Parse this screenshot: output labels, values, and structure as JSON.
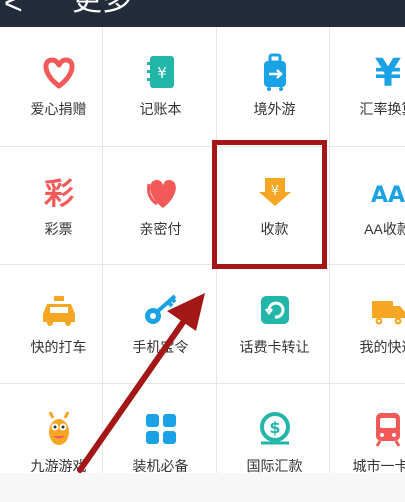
{
  "header": {
    "back_glyph": "<",
    "title": "更多"
  },
  "items": [
    {
      "label": "爱心捐赠",
      "icon": "heart-donate-icon",
      "color": "#f25a5a"
    },
    {
      "label": "记账本",
      "icon": "ledger-icon",
      "color": "#22b6a8"
    },
    {
      "label": "境外游",
      "icon": "luggage-icon",
      "color": "#1aa2e6"
    },
    {
      "label": "汇率换算",
      "icon": "currency-exchange-icon",
      "color": "#1aa2e6"
    },
    {
      "label": "彩票",
      "icon": "lottery-icon",
      "color": "#f25a5a"
    },
    {
      "label": "亲密付",
      "icon": "hearts-pay-icon",
      "color": "#f25a5a"
    },
    {
      "label": "收款",
      "icon": "receive-money-icon",
      "color": "#f6a623"
    },
    {
      "label": "AA收款",
      "icon": "aa-collect-icon",
      "color": "#1aa2e6"
    },
    {
      "label": "快的打车",
      "icon": "taxi-icon",
      "color": "#f6a623"
    },
    {
      "label": "手机宝令",
      "icon": "key-icon",
      "color": "#1aa2e6"
    },
    {
      "label": "话费卡转让",
      "icon": "phone-card-transfer-icon",
      "color": "#22b6a8"
    },
    {
      "label": "我的快递",
      "icon": "delivery-truck-icon",
      "color": "#f6a623"
    },
    {
      "label": "九游游戏",
      "icon": "game-mascot-icon",
      "color": "#f6a623"
    },
    {
      "label": "装机必备",
      "icon": "app-grid-icon",
      "color": "#1aa2e6"
    },
    {
      "label": "国际汇款",
      "icon": "intl-remit-icon",
      "color": "#22b6a8"
    },
    {
      "label": "城市一卡通",
      "icon": "metro-card-icon",
      "color": "#f25a5a"
    }
  ],
  "icon_text": {
    "lottery": "彩",
    "aa": "AA",
    "ledger": "¥",
    "currency": "¥",
    "receive": "¥",
    "intl": "$"
  },
  "annotation": {
    "highlight_color": "#a31717"
  }
}
